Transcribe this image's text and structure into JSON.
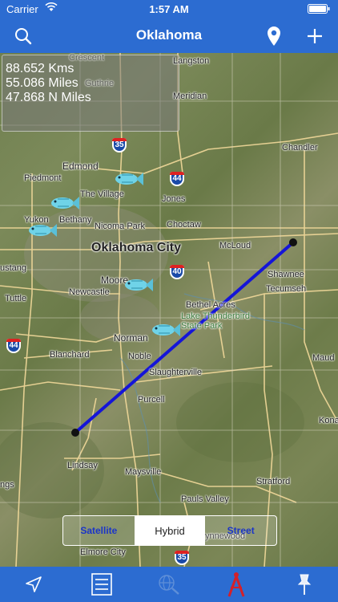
{
  "status": {
    "carrier": "Carrier",
    "time": "1:57 AM"
  },
  "nav": {
    "title": "Oklahoma"
  },
  "distance": {
    "kms": "88.652 Kms",
    "miles": "55.086 Miles",
    "nmiles": "47.868 N Miles"
  },
  "places": {
    "crescent": "Crescent",
    "guthrie": "Guthrie",
    "langston": "Langston",
    "meridian": "Meridian",
    "edmond": "Edmond",
    "piedmont": "Piedmont",
    "chandler": "Chandler",
    "the_village": "The Village",
    "jones": "Jones",
    "yukon": "Yukon",
    "bethany": "Bethany",
    "nicoma_park": "Nicoma Park",
    "choctaw": "Choctaw",
    "oklahoma_city": "Oklahoma City",
    "mcloud": "McLoud",
    "mustang": "ustang",
    "moore": "Moore",
    "shawnee": "Shawnee",
    "tecumseh": "Tecumseh",
    "bethel_acres": "Bethel Acres",
    "lake_thunderbird": "Lake Thunderbird",
    "state_park": "State Park",
    "tuttle": "Tuttle",
    "newcastle": "Newcastle",
    "norman": "Norman",
    "blanchard": "Blanchard",
    "noble": "Noble",
    "maud": "Maud",
    "slaughterville": "Slaughterville",
    "purcell": "Purcell",
    "kona": "Kona",
    "lindsay": "Lindsay",
    "maysville": "Maysville",
    "ngs": "ngs",
    "stratford": "Stratford",
    "pauls_valley": "Pauls Valley",
    "wynnewood": "ynnewood",
    "elmore_city": "Elmore City"
  },
  "shields": {
    "i35_top": "35",
    "i44_top": "44",
    "i40": "40",
    "i44_left": "44",
    "i35_bottom": "35"
  },
  "segment": {
    "satellite": "Satellite",
    "hybrid": "Hybrid",
    "street": "Street",
    "selected": "Hybrid"
  },
  "icons": {
    "search": "search-icon",
    "pin": "location-pin-icon",
    "add": "plus-icon",
    "locate": "location-arrow-icon",
    "list": "list-icon",
    "globe": "globe-search-icon",
    "compass": "drafting-compass-icon",
    "pushpin": "pushpin-icon",
    "fish": "fish-icon"
  },
  "colors": {
    "bar": "#2c6cd1",
    "route": "#1515d8",
    "segment_text": "#1b35c8",
    "compass": "#d4202a"
  }
}
